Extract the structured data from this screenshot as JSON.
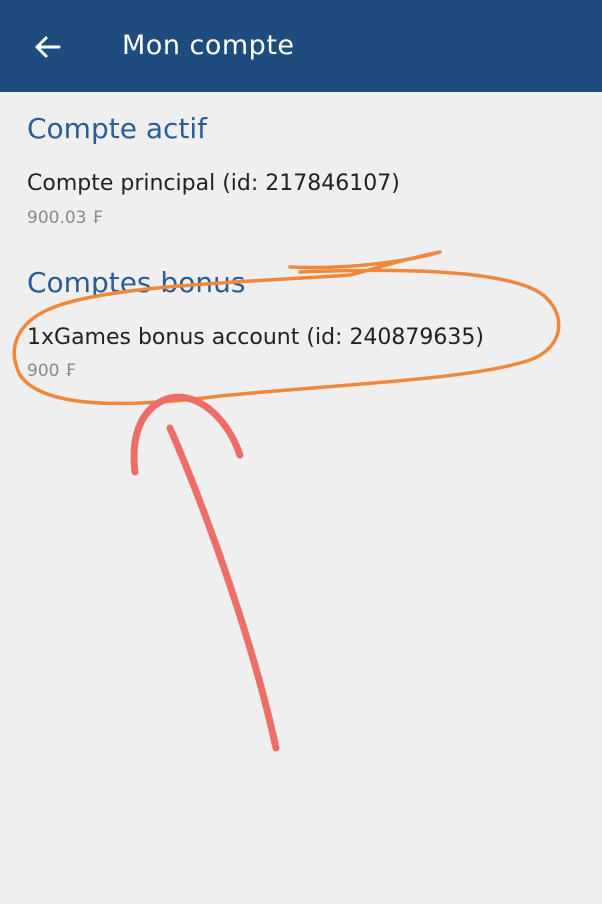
{
  "header": {
    "title": "Mon compte",
    "back_icon": "arrow-left-icon",
    "background": "#1f4c7f"
  },
  "active_account": {
    "section_title": "Compte actif",
    "name": "Compte principal (id: 217846107)",
    "balance": "900.03 ₣"
  },
  "bonus_accounts": {
    "section_title": "Comptes bonus",
    "items": [
      {
        "name": "1xGames bonus account (id: 240879635)",
        "balance": "900 ₣"
      }
    ]
  },
  "annotations": {
    "circle_color": "#f0883c",
    "arrow_color": "#ee6d66"
  }
}
